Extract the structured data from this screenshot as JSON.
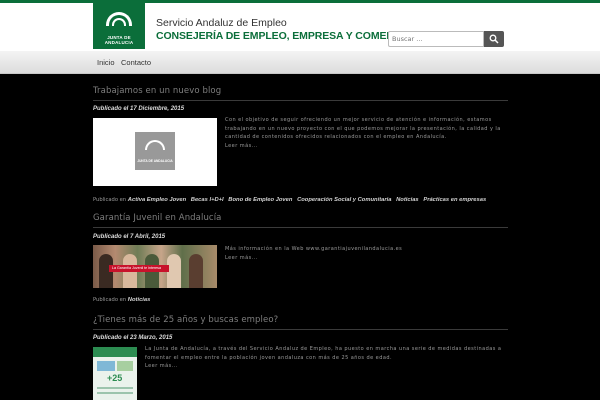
{
  "header": {
    "logo_text": "JUNTA DE ANDALUCIA",
    "service_name": "Servicio Andaluz de Empleo",
    "department": "CONSEJERÍA DE EMPLEO, EMPRESA Y COMERCIO",
    "search_placeholder": "Buscar ...",
    "brand_color": "#0b6e3a"
  },
  "nav": {
    "items": [
      {
        "label": "Inicio"
      },
      {
        "label": "Contacto"
      }
    ]
  },
  "posts": [
    {
      "title": "Trabajamos en un nuevo blog",
      "published": "Publicado el 17 Diciembre, 2015",
      "thumb_text": "JUNTA DE ANDALUCIA",
      "excerpt": "Con el objetivo de seguir ofreciendo un mejor servicio de atención e información, estamos trabajando en un nuevo proyecto con el que podemos mejorar la presentación, la calidad y la cantidad de contenidos ofrecidos relacionados con el empleo en Andalucía.",
      "more": "Leer más...",
      "categories_label": "Publicado en",
      "categories": [
        "Activa Empleo Joven",
        "Becas I+D+I",
        "Bono de Empleo Joven",
        "Cooperación Social y Comunitaria",
        "Noticias",
        "Prácticas en empresas"
      ]
    },
    {
      "title": "Garantía Juvenil en Andalucía",
      "published": "Publicado el 7 Abril, 2015",
      "thumb_text": "La Garantía Juvenil te interesa",
      "excerpt": "Más información en la Web www.garantiajuvenilandalucia.es",
      "more": "Leer más...",
      "categories_label": "Publicado en",
      "categories": [
        "Noticias"
      ]
    },
    {
      "title": "¿Tienes más de 25 años y buscas empleo?",
      "published": "Publicado el 23 Marzo, 2015",
      "thumb_text": "+25",
      "excerpt": "La Junta de Andalucía, a través del Servicio Andaluz de Empleo, ha puesto en marcha una serie de medidas destinadas a fomentar el empleo entre la población joven andaluza con más de 25 años de edad.",
      "more": "Leer más..."
    }
  ]
}
